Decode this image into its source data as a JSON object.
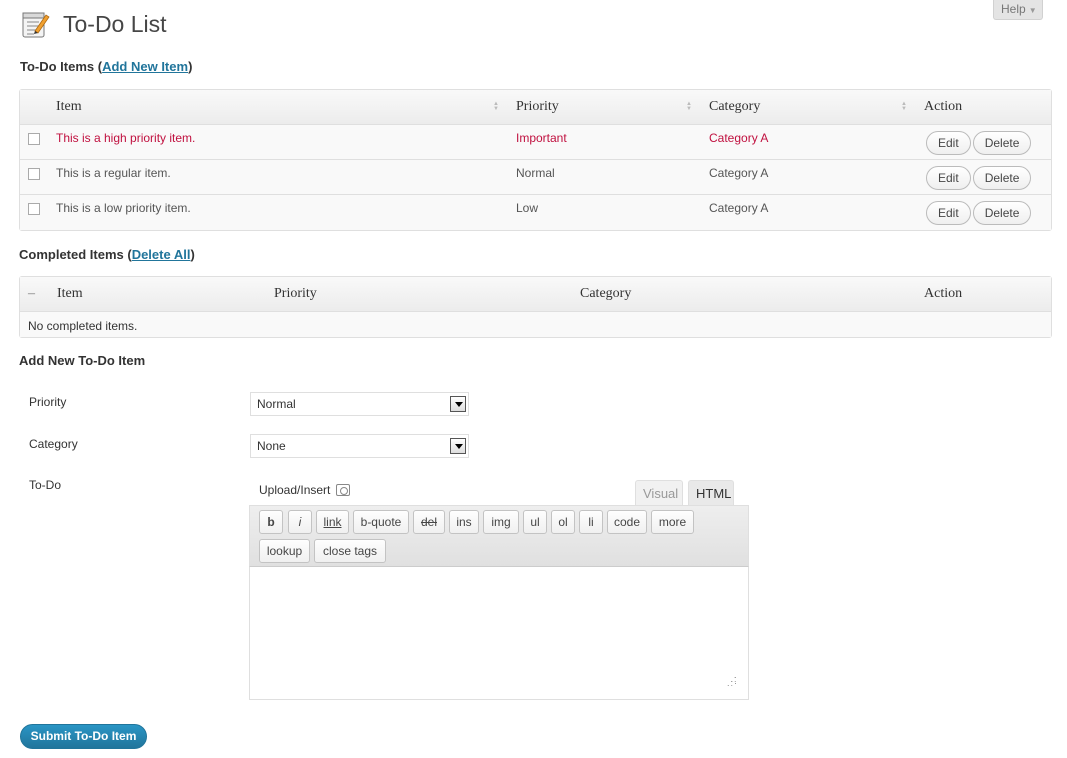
{
  "page": {
    "title": "To-Do List",
    "help_label": "Help"
  },
  "todo_section": {
    "heading_prefix": "To-Do Items (",
    "add_new_link": "Add New Item",
    "heading_suffix": ")",
    "columns": [
      "Item",
      "Priority",
      "Category",
      "Action"
    ],
    "rows": [
      {
        "item": "This is a high priority item.",
        "priority": "Important",
        "category": "Category A",
        "high": true
      },
      {
        "item": "This is a regular item.",
        "priority": "Normal",
        "category": "Category A",
        "high": false
      },
      {
        "item": "This is a low priority item.",
        "priority": "Low",
        "category": "Category A",
        "high": false
      }
    ],
    "edit_label": "Edit",
    "delete_label": "Delete"
  },
  "completed_section": {
    "heading_prefix": "Completed Items (",
    "delete_all_link": "Delete All",
    "heading_suffix": ")",
    "collapse_symbol": "–",
    "columns": [
      "Item",
      "Priority",
      "Category",
      "Action"
    ],
    "empty_text": "No completed items."
  },
  "add_form": {
    "heading": "Add New To-Do Item",
    "priority_label": "Priority",
    "priority_value": "Normal",
    "category_label": "Category",
    "category_value": "None",
    "todo_label": "To-Do",
    "upload_label": "Upload/Insert",
    "tab_visual": "Visual",
    "tab_html": "HTML",
    "toolbar_row1": [
      "b",
      "i",
      "link",
      "b-quote",
      "del",
      "ins",
      "img",
      "ul",
      "ol",
      "li",
      "code",
      "more"
    ],
    "toolbar_row2": [
      "lookup",
      "close tags"
    ],
    "submit_label": "Submit To-Do Item"
  },
  "colors": {
    "accent": "#21759b",
    "high_priority": "#c0103f"
  },
  "icons": [
    "todo-list-page-icon",
    "sort-arrows-icon",
    "dropdown-arrow-icon",
    "upload-media-icon",
    "resize-grip-icon"
  ]
}
